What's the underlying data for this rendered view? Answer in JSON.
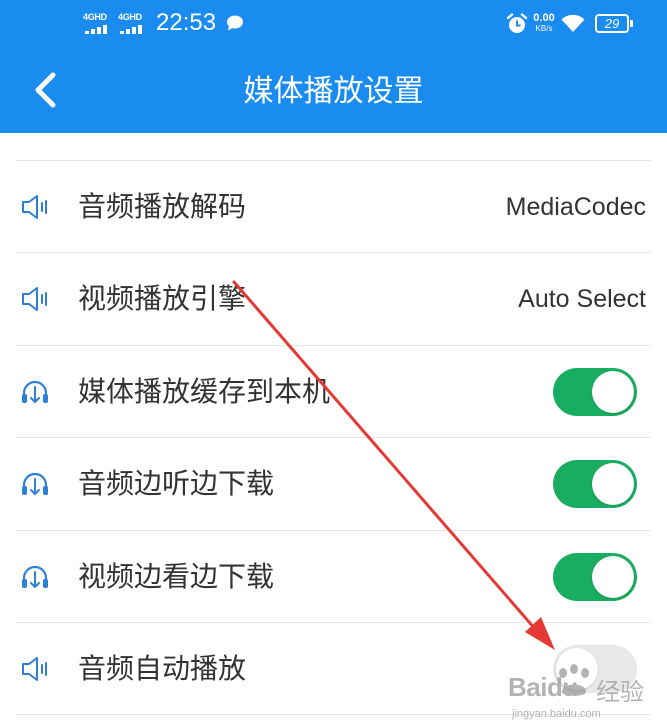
{
  "status_bar": {
    "sim1_network": "4GHD",
    "sim2_network": "4GHD",
    "time": "22:53",
    "net_speed_value": "0.00",
    "net_speed_unit": "KB/s",
    "battery_level": "29",
    "icons": [
      "signal-icon",
      "chat-bubble-icon",
      "alarm-icon",
      "wifi-icon",
      "battery-icon"
    ]
  },
  "header": {
    "title": "媒体播放设置",
    "back_icon": "chevron-left-icon",
    "background_color": "#1a8cf0"
  },
  "settings": [
    {
      "label": "音频播放解码",
      "icon": "speaker-icon",
      "value": "MediaCodec"
    },
    {
      "label": "视频播放引擎",
      "icon": "speaker-icon",
      "value": "Auto Select"
    },
    {
      "label": "媒体播放缓存到本机",
      "icon": "headphones-download-icon",
      "toggle": true
    },
    {
      "label": "音频边听边下载",
      "icon": "headphones-download-icon",
      "toggle": true
    },
    {
      "label": "视频边看边下载",
      "icon": "headphones-download-icon",
      "toggle": true
    },
    {
      "label": "音频自动播放",
      "icon": "speaker-icon",
      "toggle": false
    }
  ],
  "colors": {
    "accent": "#1a8cf0",
    "toggle_on": "#19ad61",
    "toggle_off": "#e8e8e8",
    "annotation_arrow": "#e53935"
  },
  "watermark": {
    "brand": "Baidu",
    "suffix": "经验",
    "url": "jingyan.baidu.com"
  }
}
